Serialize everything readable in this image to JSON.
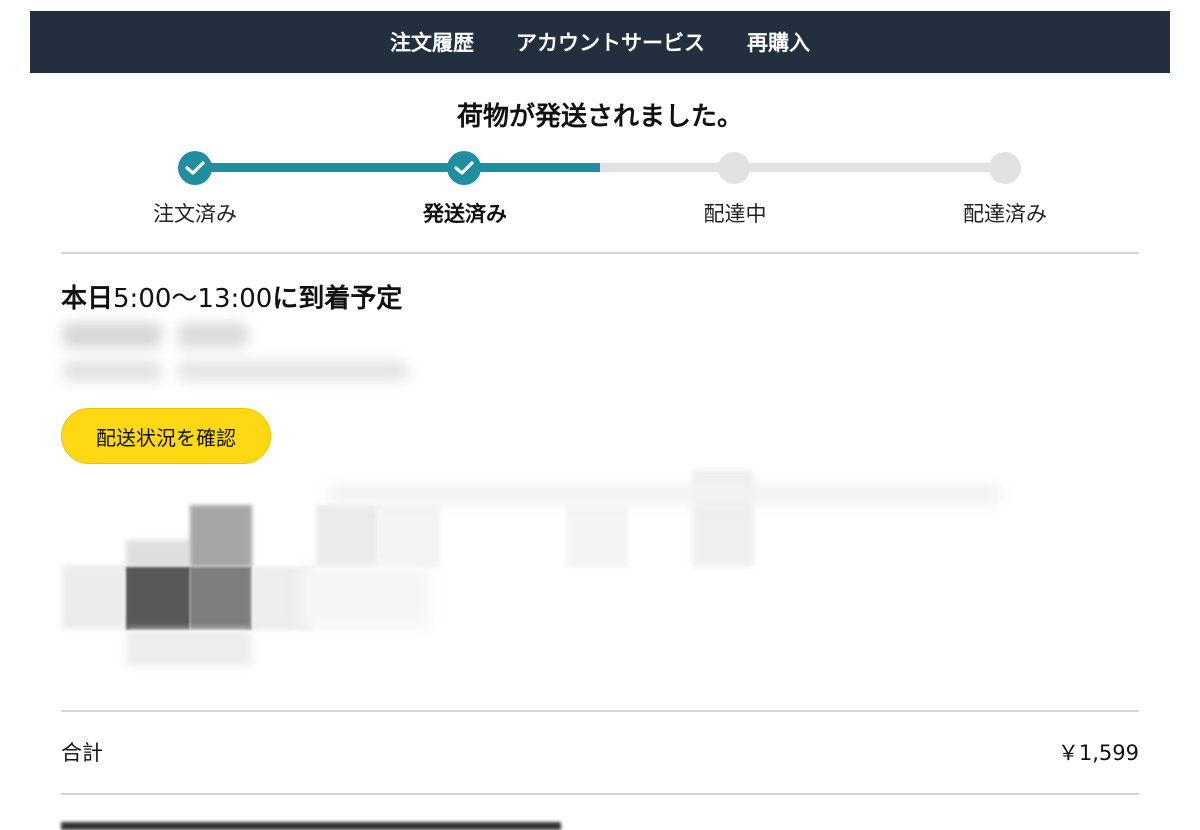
{
  "nav": {
    "order_history": "注文履歴",
    "account_service": "アカウントサービス",
    "rebuy": "再購入"
  },
  "status_title": "荷物が発送されました。",
  "progress": {
    "steps": [
      {
        "label": "注文済み",
        "state": "done"
      },
      {
        "label": "発送済み",
        "state": "done",
        "current": true
      },
      {
        "label": "配達中",
        "state": "pending"
      },
      {
        "label": "配達済み",
        "state": "pending"
      }
    ],
    "fill_fraction": 0.5,
    "done_color": "#1e8ea0",
    "pending_color": "#e3e1e3"
  },
  "arrival": {
    "prefix": "本日",
    "time": "5:00〜13:00",
    "suffix": "に到着予定"
  },
  "track_button_label": "配送状況を確認",
  "summary": {
    "total_label": "合計",
    "total_value": "￥1,599"
  },
  "colors": {
    "navbar": "#232f3e",
    "button": "#ffd814"
  },
  "icons": [
    "check-icon"
  ]
}
